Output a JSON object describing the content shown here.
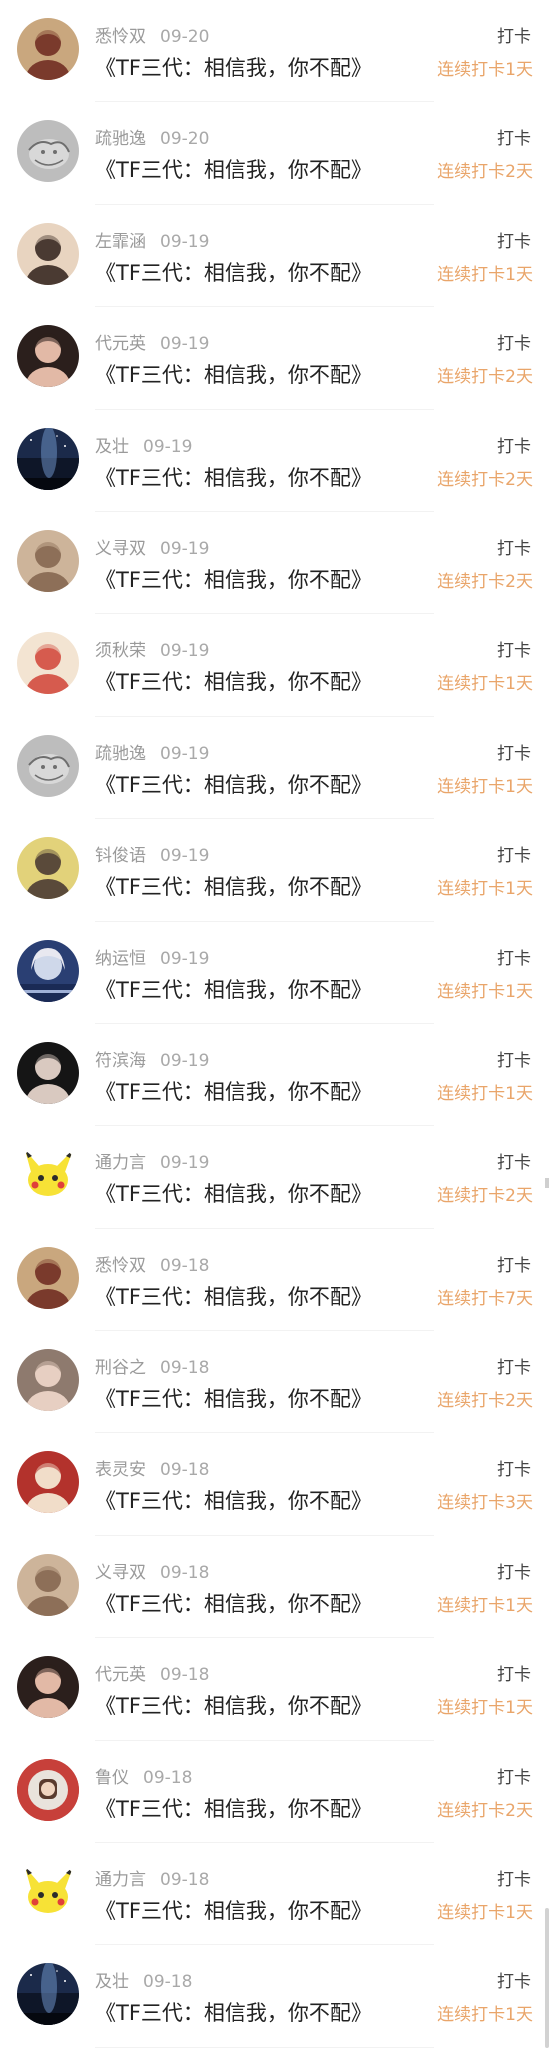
{
  "colors": {
    "streak": "#e9a56a",
    "name": "#9a9a9a",
    "book": "#222222",
    "checkin": "#444444"
  },
  "entries": [
    {
      "name": "悉怜双",
      "date": "09-20",
      "book": "《TF三代：相信我，你不配》",
      "type": "打卡",
      "streak": "连续打卡1天",
      "avatar": "avatar-girl-brown",
      "avatar_colors": [
        "#c9a77e",
        "#7a3a2c"
      ]
    },
    {
      "name": "疏驰逸",
      "date": "09-20",
      "book": "《TF三代：相信我，你不配》",
      "type": "打卡",
      "streak": "连续打卡2天",
      "avatar": "avatar-cat-sketch",
      "avatar_colors": [
        "#bdbdbd",
        "#6e6e6e"
      ]
    },
    {
      "name": "左霏涵",
      "date": "09-19",
      "book": "《TF三代：相信我，你不配》",
      "type": "打卡",
      "streak": "连续打卡1天",
      "avatar": "avatar-blonde-girl",
      "avatar_colors": [
        "#e8d4c0",
        "#4a3a32"
      ]
    },
    {
      "name": "代元英",
      "date": "09-19",
      "book": "《TF三代：相信我，你不配》",
      "type": "打卡",
      "streak": "连续打卡2天",
      "avatar": "avatar-dark-hair-girl",
      "avatar_colors": [
        "#2b1f1c",
        "#e2b9a6"
      ]
    },
    {
      "name": "及壮",
      "date": "09-19",
      "book": "《TF三代：相信我，你不配》",
      "type": "打卡",
      "streak": "连续打卡2天",
      "avatar": "avatar-night-sky",
      "avatar_colors": [
        "#1b2a4a",
        "#6b8fc2"
      ]
    },
    {
      "name": "义寻双",
      "date": "09-19",
      "book": "《TF三代：相信我，你不配》",
      "type": "打卡",
      "streak": "连续打卡2天",
      "avatar": "avatar-beige-girl",
      "avatar_colors": [
        "#cdb49a",
        "#8d6f58"
      ]
    },
    {
      "name": "须秋荣",
      "date": "09-19",
      "book": "《TF三代：相信我，你不配》",
      "type": "打卡",
      "streak": "连续打卡1天",
      "avatar": "avatar-anime-fox",
      "avatar_colors": [
        "#f3e4d2",
        "#d65b4e"
      ]
    },
    {
      "name": "疏驰逸",
      "date": "09-19",
      "book": "《TF三代：相信我，你不配》",
      "type": "打卡",
      "streak": "连续打卡1天",
      "avatar": "avatar-cat-sketch",
      "avatar_colors": [
        "#bdbdbd",
        "#6e6e6e"
      ]
    },
    {
      "name": "钭俊语",
      "date": "09-19",
      "book": "《TF三代：相信我，你不配》",
      "type": "打卡",
      "streak": "连续打卡1天",
      "avatar": "avatar-yellow-portrait",
      "avatar_colors": [
        "#e2d27a",
        "#5a4a3a"
      ]
    },
    {
      "name": "纳运恒",
      "date": "09-19",
      "book": "《TF三代：相信我，你不配》",
      "type": "打卡",
      "streak": "连续打卡1天",
      "avatar": "avatar-blue-anime",
      "avatar_colors": [
        "#2a3f73",
        "#cfd8ea"
      ]
    },
    {
      "name": "符滨海",
      "date": "09-19",
      "book": "《TF三代：相信我，你不配》",
      "type": "打卡",
      "streak": "连续打卡1天",
      "avatar": "avatar-dark-portrait",
      "avatar_colors": [
        "#151515",
        "#d9c9c0"
      ]
    },
    {
      "name": "通力言",
      "date": "09-19",
      "book": "《TF三代：相信我，你不配》",
      "type": "打卡",
      "streak": "连续打卡2天",
      "avatar": "avatar-pikachu",
      "avatar_colors": [
        "#f7e236",
        "#2b2b2b"
      ]
    },
    {
      "name": "悉怜双",
      "date": "09-18",
      "book": "《TF三代：相信我，你不配》",
      "type": "打卡",
      "streak": "连续打卡7天",
      "avatar": "avatar-girl-brown",
      "avatar_colors": [
        "#c9a77e",
        "#7a3a2c"
      ]
    },
    {
      "name": "刑谷之",
      "date": "09-18",
      "book": "《TF三代：相信我，你不配》",
      "type": "打卡",
      "streak": "连续打卡2天",
      "avatar": "avatar-two-faces",
      "avatar_colors": [
        "#8e7a6e",
        "#e7cfc2"
      ]
    },
    {
      "name": "表灵安",
      "date": "09-18",
      "book": "《TF三代：相信我，你不配》",
      "type": "打卡",
      "streak": "连续打卡3天",
      "avatar": "avatar-red-anime",
      "avatar_colors": [
        "#b3322c",
        "#f1ddc9"
      ]
    },
    {
      "name": "义寻双",
      "date": "09-18",
      "book": "《TF三代：相信我，你不配》",
      "type": "打卡",
      "streak": "连续打卡1天",
      "avatar": "avatar-beige-girl",
      "avatar_colors": [
        "#cdb49a",
        "#8d6f58"
      ]
    },
    {
      "name": "代元英",
      "date": "09-18",
      "book": "《TF三代：相信我，你不配》",
      "type": "打卡",
      "streak": "连续打卡1天",
      "avatar": "avatar-dark-hair-girl",
      "avatar_colors": [
        "#2b1f1c",
        "#e2b9a6"
      ]
    },
    {
      "name": "鲁仪",
      "date": "09-18",
      "book": "《TF三代：相信我，你不配》",
      "type": "打卡",
      "streak": "连续打卡2天",
      "avatar": "avatar-red-ring-cartoon",
      "avatar_colors": [
        "#c7403a",
        "#e9e3dc"
      ]
    },
    {
      "name": "通力言",
      "date": "09-18",
      "book": "《TF三代：相信我，你不配》",
      "type": "打卡",
      "streak": "连续打卡1天",
      "avatar": "avatar-pikachu",
      "avatar_colors": [
        "#f7e236",
        "#2b2b2b"
      ]
    },
    {
      "name": "及壮",
      "date": "09-18",
      "book": "《TF三代：相信我，你不配》",
      "type": "打卡",
      "streak": "连续打卡1天",
      "avatar": "avatar-night-sky",
      "avatar_colors": [
        "#1b2a4a",
        "#6b8fc2"
      ]
    }
  ]
}
